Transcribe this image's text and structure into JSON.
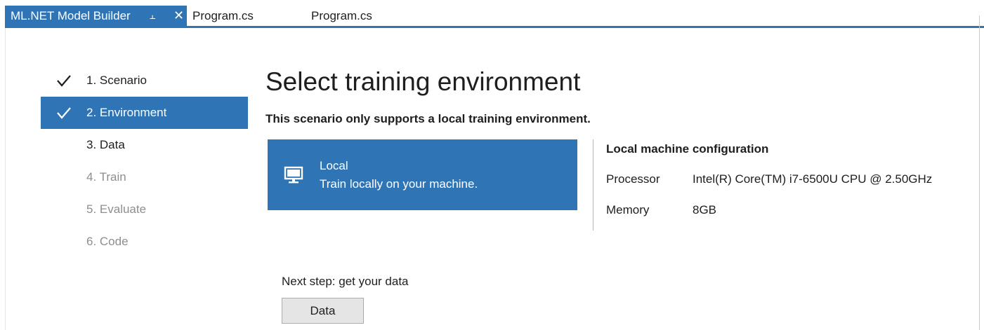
{
  "tabs": [
    {
      "label": "ML.NET Model Builder",
      "active": true
    },
    {
      "label": "Program.cs",
      "active": false
    },
    {
      "label": "Program.cs",
      "active": false
    }
  ],
  "steps": [
    {
      "label": "1. Scenario",
      "state": "done"
    },
    {
      "label": "2. Environment",
      "state": "current"
    },
    {
      "label": "3. Data",
      "state": "todo"
    },
    {
      "label": "4. Train",
      "state": "disabled"
    },
    {
      "label": "5. Evaluate",
      "state": "disabled"
    },
    {
      "label": "6. Code",
      "state": "disabled"
    }
  ],
  "main": {
    "title": "Select training environment",
    "subtitle": "This scenario only supports a local training environment.",
    "environment": {
      "name": "Local",
      "description": "Train locally on your machine.",
      "icon": "monitor-icon"
    },
    "config": {
      "title": "Local machine configuration",
      "rows": [
        {
          "label": "Processor",
          "value": "Intel(R) Core(TM) i7-6500U CPU @ 2.50GHz"
        },
        {
          "label": "Memory",
          "value": "8GB"
        }
      ]
    },
    "next_step_label": "Next step: get your data",
    "next_button_label": "Data"
  },
  "colors": {
    "accent": "#2f75b6",
    "disabled_text": "#8e8e8e"
  }
}
